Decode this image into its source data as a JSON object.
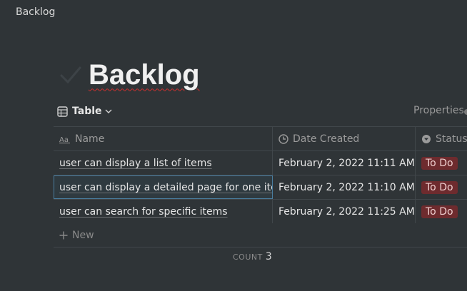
{
  "breadcrumb": {
    "label": "Backlog"
  },
  "page": {
    "title": "Backlog"
  },
  "view": {
    "label": "Table",
    "properties_label": "Properties"
  },
  "table": {
    "headers": {
      "name": "Name",
      "date": "Date Created",
      "status": "Status"
    },
    "rows": [
      {
        "name": "user can display a list of items",
        "date": "February 2, 2022 11:11 AM",
        "status": "To Do"
      },
      {
        "name": "user can display a detailed page for one item",
        "date": "February 2, 2022 11:10 AM",
        "status": "To Do"
      },
      {
        "name": "user can search for specific items",
        "date": "February 2, 2022 11:25 AM",
        "status": "To Do"
      }
    ],
    "new_label": "New"
  },
  "footer": {
    "count_label": "COUNT",
    "count_value": "3"
  },
  "colors": {
    "background": "#2f3437",
    "status_badge": "#6e2b2e",
    "selection": "#4a7ea0"
  }
}
